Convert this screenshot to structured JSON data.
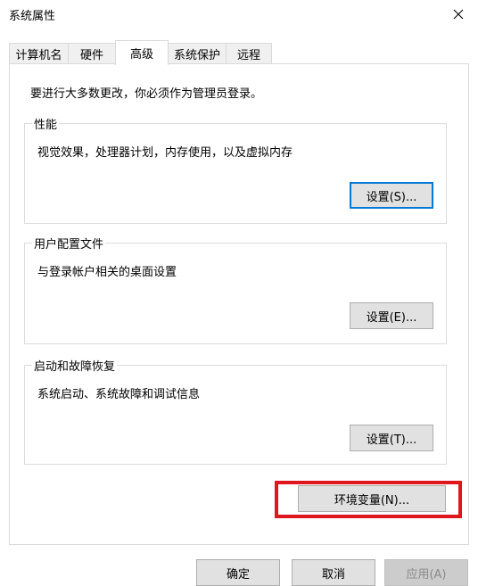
{
  "window": {
    "title": "系统属性"
  },
  "tabs": [
    "计算机名",
    "硬件",
    "高级",
    "系统保护",
    "远程"
  ],
  "admin_note": "要进行大多数更改，你必须作为管理员登录。",
  "groups": {
    "performance": {
      "title": "性能",
      "desc": "视觉效果，处理器计划，内存使用，以及虚拟内存",
      "button": "设置(S)..."
    },
    "profile": {
      "title": "用户配置文件",
      "desc": "与登录帐户相关的桌面设置",
      "button": "设置(E)..."
    },
    "startup": {
      "title": "启动和故障恢复",
      "desc": "系统启动、系统故障和调试信息",
      "button": "设置(T)..."
    }
  },
  "env_button": "环境变量(N)...",
  "footer": {
    "ok": "确定",
    "cancel": "取消",
    "apply": "应用(A)"
  },
  "colors": {
    "highlight": "#e0161e",
    "focus": "#0078d7"
  },
  "icons": {
    "close": "close-icon"
  }
}
